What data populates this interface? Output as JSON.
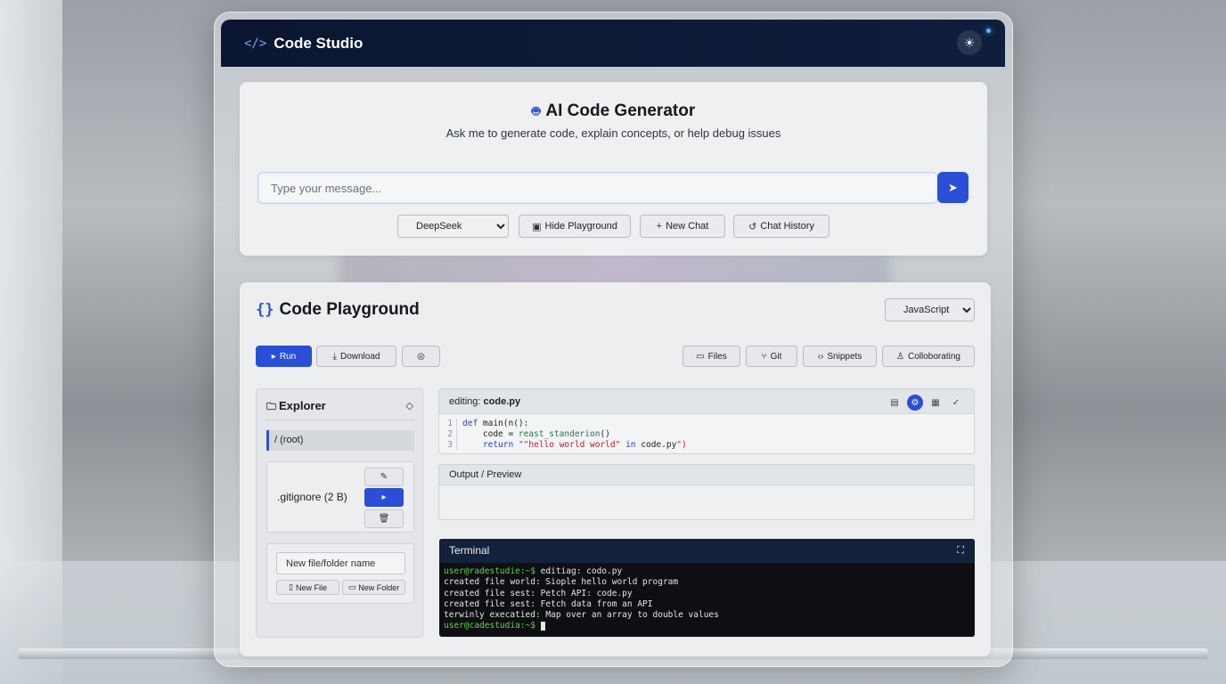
{
  "header": {
    "logo_icon": "code-icon",
    "title": "Code Studio",
    "theme_icon": "sun-icon"
  },
  "generator": {
    "icon": "robot-icon",
    "title": "AI Code Generator",
    "subtitle": "Ask me to generate code, explain concepts, or help debug issues",
    "input_placeholder": "Type your message...",
    "send_icon": "send-icon",
    "model_selected": "DeepSeek",
    "hide_playground": "Hide Playground",
    "new_chat": "New Chat",
    "chat_history": "Chat History"
  },
  "playground": {
    "icon": "braces-icon",
    "title": "Code Playground",
    "language_selected": "JavaScript",
    "run": "Run",
    "download": "Download",
    "files": "Files",
    "git": "Git",
    "snippets": "Snippets",
    "collaborating": "Colloborating"
  },
  "explorer": {
    "title": "Explorer",
    "root": "/ (root)",
    "file": ".gitignore (2 B)",
    "new_placeholder": "New file/folder name",
    "new_file": "New File",
    "new_folder": "New Folder"
  },
  "editor": {
    "editing_label": "editing:",
    "filename": "code.py",
    "lines": [
      {
        "n": "1",
        "text": "def main(n():"
      },
      {
        "n": "2",
        "text": "    code = reast_standerion()"
      },
      {
        "n": "3",
        "text": "    return \"\"hello world world\" in code.py\")"
      }
    ]
  },
  "output": {
    "title": "Output / Preview"
  },
  "terminal": {
    "title": "Terminal",
    "prompt1": "user@radestudie:~$",
    "cmd1": " editiag: codo.py",
    "lines": [
      "created file world: Siople hello world program",
      "created file sest: Petch API: code.py",
      "created file sest: Fetch data from an API",
      "terwinly execatied: Map over an array to double values"
    ],
    "prompt2": "user@cadestudia:~$"
  },
  "colors": {
    "accent": "#2a4fd6",
    "header_bg": "#0b1630",
    "terminal_bg": "#0d0f12",
    "prompt": "#6ad04a"
  }
}
